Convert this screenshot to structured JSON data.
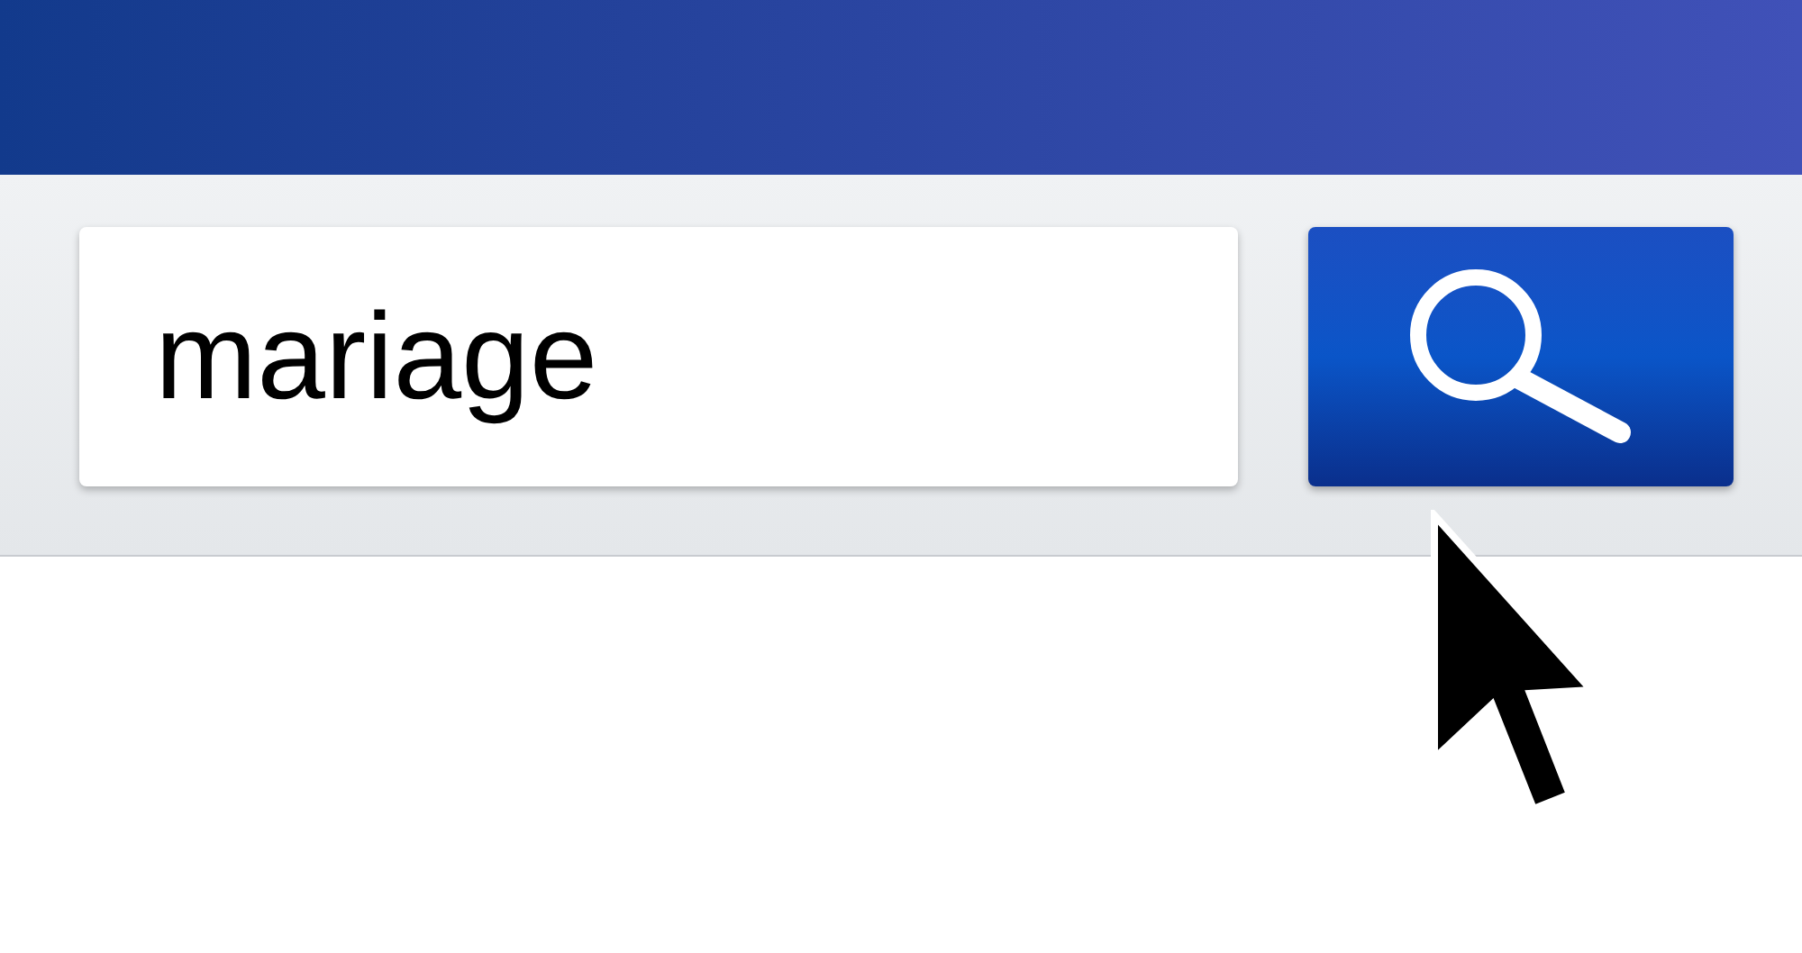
{
  "search": {
    "value": "mariage"
  }
}
